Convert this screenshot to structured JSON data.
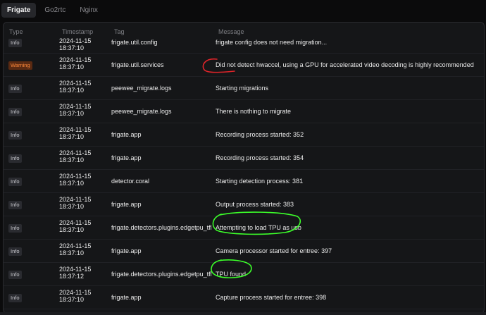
{
  "tabs": [
    {
      "label": "Frigate",
      "active": true
    },
    {
      "label": "Go2rtc",
      "active": false
    },
    {
      "label": "Nginx",
      "active": false
    }
  ],
  "table": {
    "headers": {
      "type": "Type",
      "timestamp": "Timestamp",
      "tag": "Tag",
      "message": "Message"
    },
    "rows": [
      {
        "type": "Info",
        "date": "2024-11-15",
        "time": "18:37:10",
        "tag": "frigate.util.config",
        "message": "frigate config does not need migration..."
      },
      {
        "type": "Warning",
        "date": "2024-11-15",
        "time": "18:37:10",
        "tag": "frigate.util.services",
        "message": "Did not detect hwaccel, using a GPU for accelerated video decoding is highly recommended"
      },
      {
        "type": "Info",
        "date": "2024-11-15",
        "time": "18:37:10",
        "tag": "peewee_migrate.logs",
        "message": "Starting migrations"
      },
      {
        "type": "Info",
        "date": "2024-11-15",
        "time": "18:37:10",
        "tag": "peewee_migrate.logs",
        "message": "There is nothing to migrate"
      },
      {
        "type": "Info",
        "date": "2024-11-15",
        "time": "18:37:10",
        "tag": "frigate.app",
        "message": "Recording process started: 352"
      },
      {
        "type": "Info",
        "date": "2024-11-15",
        "time": "18:37:10",
        "tag": "frigate.app",
        "message": "Recording process started: 354"
      },
      {
        "type": "Info",
        "date": "2024-11-15",
        "time": "18:37:10",
        "tag": "detector.coral",
        "message": "Starting detection process: 381"
      },
      {
        "type": "Info",
        "date": "2024-11-15",
        "time": "18:37:10",
        "tag": "frigate.app",
        "message": "Output process started: 383"
      },
      {
        "type": "Info",
        "date": "2024-11-15",
        "time": "18:37:10",
        "tag": "frigate.detectors.plugins.edgetpu_tfl",
        "message": "Attempting to load TPU as usb"
      },
      {
        "type": "Info",
        "date": "2024-11-15",
        "time": "18:37:10",
        "tag": "frigate.app",
        "message": "Camera processor started for entree: 397"
      },
      {
        "type": "Info",
        "date": "2024-11-15",
        "time": "18:37:12",
        "tag": "frigate.detectors.plugins.edgetpu_tfl",
        "message": "TPU found"
      },
      {
        "type": "Info",
        "date": "2024-11-15",
        "time": "18:37:10",
        "tag": "frigate.app",
        "message": "Capture process started for entree: 398"
      }
    ]
  },
  "colors": {
    "warning": "#ff8a3c",
    "annotation_red": "#e0242a",
    "annotation_green": "#3cff2a"
  }
}
